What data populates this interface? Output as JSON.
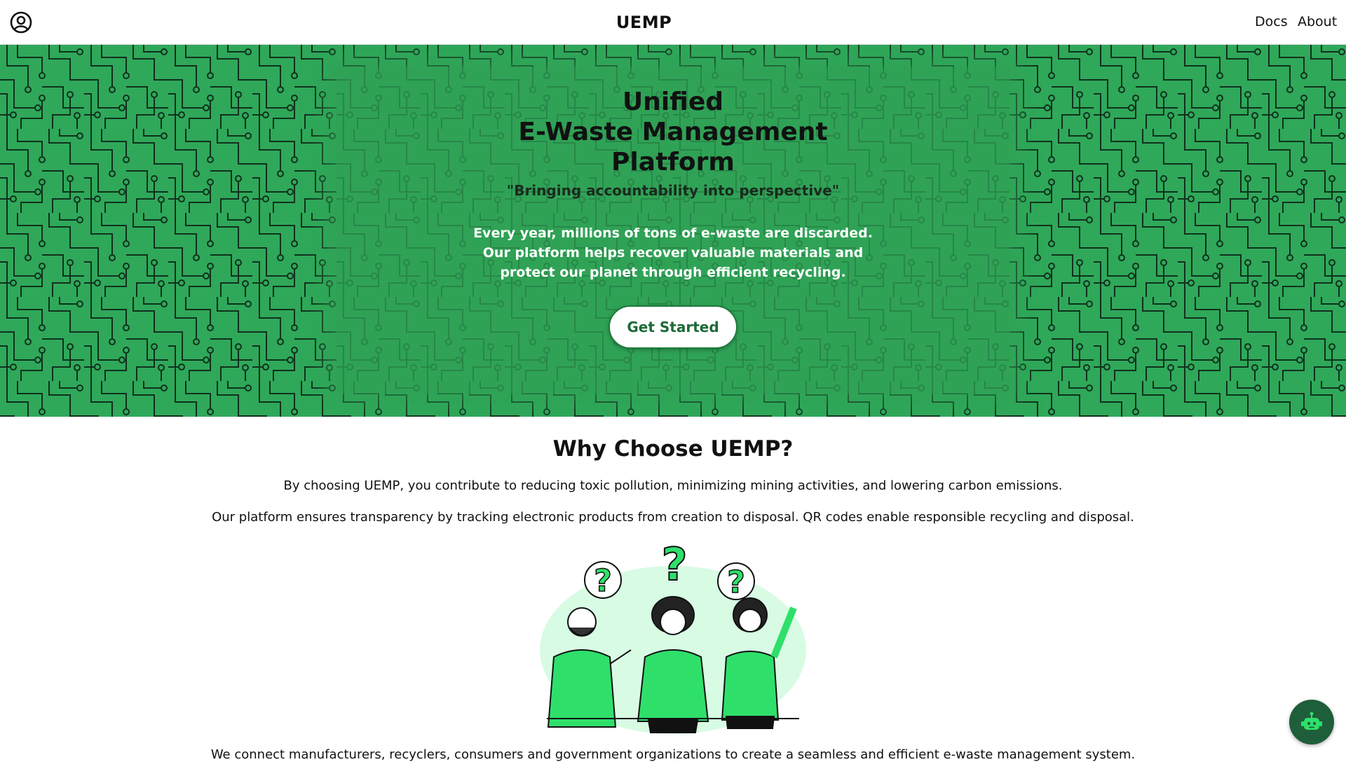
{
  "header": {
    "brand": "UEMP",
    "nav": {
      "docs": "Docs",
      "about": "About"
    }
  },
  "icons": {
    "profile": "user-circle-icon",
    "chatbot": "robot-icon"
  },
  "colors": {
    "hero_green": "#2fa85a",
    "accent_green": "#2ee06a",
    "bot_bg": "#1f5e3a"
  },
  "hero": {
    "title_lines": [
      "Unified",
      "E-Waste Management",
      "Platform"
    ],
    "subtitle": "\"Bringing accountability into perspective\"",
    "description": "Every year, millions of tons of e-waste are discarded. Our platform helps recover valuable materials and protect our planet through efficient recycling.",
    "cta": "Get Started"
  },
  "why": {
    "title": "Why Choose UEMP?",
    "p1": "By choosing UEMP, you contribute to reducing toxic pollution, minimizing mining activities, and lowering carbon emissions.",
    "p2": "Our platform ensures transparency by tracking electronic products from creation to disposal. QR codes enable responsible recycling and disposal.",
    "p3": "We connect manufacturers, recyclers, consumers and government organizations to create a seamless and efficient e-waste management system."
  }
}
